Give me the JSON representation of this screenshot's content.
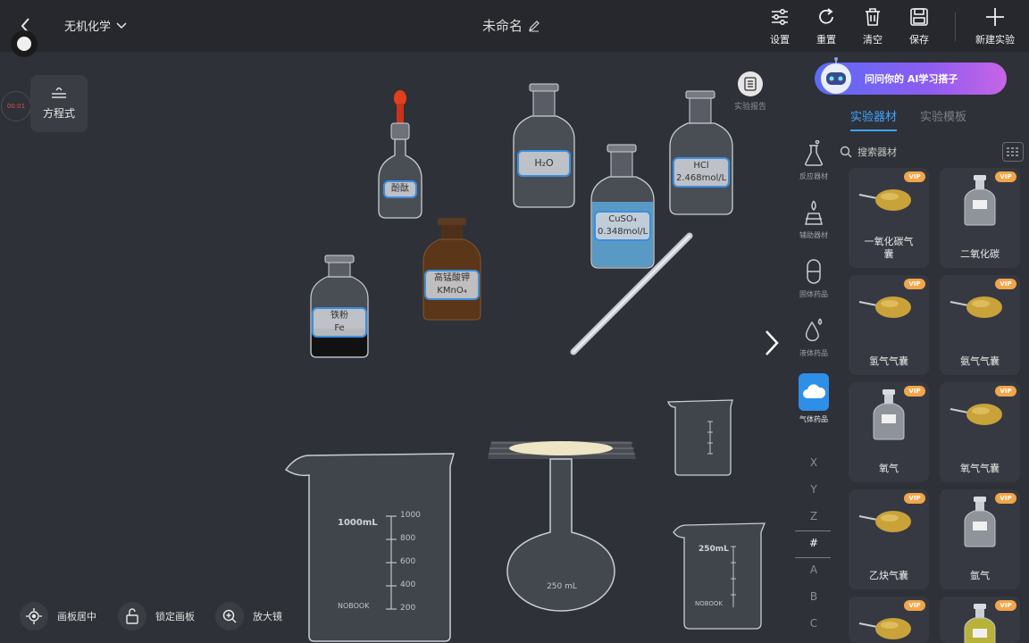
{
  "topbar": {
    "subject": "无机化学",
    "doc_title": "未命名",
    "tools": [
      {
        "label": "设置",
        "icon": "sliders-icon"
      },
      {
        "label": "重置",
        "icon": "refresh-icon"
      },
      {
        "label": "清空",
        "icon": "trash-icon"
      },
      {
        "label": "保存",
        "icon": "save-icon"
      },
      {
        "label": "新建实验",
        "icon": "plus-icon"
      }
    ]
  },
  "left": {
    "record_label": "00:01",
    "equation_label": "方程式",
    "bottom_controls": [
      {
        "label": "画板居中",
        "icon": "target-icon"
      },
      {
        "label": "锁定画板",
        "icon": "lock-icon"
      },
      {
        "label": "放大镜",
        "icon": "zoom-icon"
      }
    ]
  },
  "canvas": {
    "report_label": "实验报告",
    "bottles": [
      {
        "name": "indicator",
        "label": "酚酞"
      },
      {
        "name": "water",
        "label": "H₂O"
      },
      {
        "name": "hcl",
        "label": "HCl\n2.468mol/L"
      },
      {
        "name": "cuso4",
        "label": "CuSO₄\n0.348mol/L"
      },
      {
        "name": "kmno4",
        "label": "高锰酸钾\nKMnO₄"
      },
      {
        "name": "iron",
        "label": "铁粉\nFe"
      }
    ],
    "beaker_large": {
      "volume": "1000mL",
      "brand": "NOBOOK",
      "scale": [
        "1000",
        "800",
        "600",
        "400",
        "200"
      ]
    },
    "flask_label": "250 mL",
    "beaker_small": {
      "volume": "250mL",
      "brand": "NOBOOK"
    }
  },
  "panel": {
    "ai_banner": "问问你的 AI学习搭子",
    "tabs": [
      "实验器材",
      "实验模板"
    ],
    "active_tab": 0,
    "search_placeholder": "搜索器材",
    "categories": [
      {
        "label": "反应器材",
        "icon": "flask-icon"
      },
      {
        "label": "辅助器材",
        "icon": "burner-icon"
      },
      {
        "label": "固体药品",
        "icon": "capsule-icon"
      },
      {
        "label": "液体药品",
        "icon": "drop-icon"
      },
      {
        "label": "气体药品",
        "icon": "cloud-icon"
      }
    ],
    "active_category": 4,
    "alphabet": [
      "X",
      "Y",
      "Z",
      "#",
      "A",
      "B",
      "C"
    ],
    "vip_badge": "VIP",
    "items": [
      {
        "name": "一氧化碳气囊",
        "type": "bag"
      },
      {
        "name": "二氧化碳",
        "type": "bottle"
      },
      {
        "name": "氢气气囊",
        "type": "bag"
      },
      {
        "name": "氨气气囊",
        "type": "bag"
      },
      {
        "name": "氧气",
        "type": "bottle"
      },
      {
        "name": "氧气气囊",
        "type": "bag"
      },
      {
        "name": "乙炔气囊",
        "type": "bag"
      },
      {
        "name": "氩气",
        "type": "bottle"
      },
      {
        "name": "",
        "type": "bag"
      },
      {
        "name": "",
        "type": "bottle-yellow"
      }
    ]
  },
  "colors": {
    "background": "#2e3138",
    "topbar": "#26282d",
    "accent": "#3ea5ff",
    "vip": "#f2a64a",
    "card": "#363941"
  }
}
